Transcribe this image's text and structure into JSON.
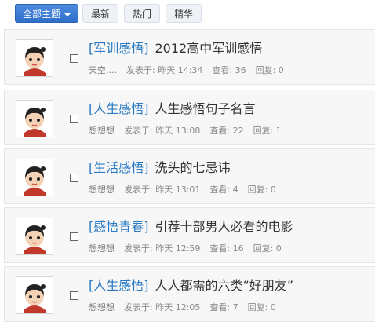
{
  "tabs": {
    "all": "全部主题",
    "latest": "最新",
    "hot": "热门",
    "essence": "精华"
  },
  "threads": [
    {
      "category": "[军训感悟]",
      "subject": "2012高中军训感悟",
      "author": "天空....",
      "posted": "发表于: 昨天 14:34",
      "views": "查看: 36",
      "replies": "回复: 0"
    },
    {
      "category": "[人生感悟]",
      "subject": "人生感悟句子名言",
      "author": "想想想",
      "posted": "发表于: 昨天 13:08",
      "views": "查看: 22",
      "replies": "回复: 1"
    },
    {
      "category": "[生活感悟]",
      "subject": "洗头的七忌讳",
      "author": "想想想",
      "posted": "发表于: 昨天 13:01",
      "views": "查看: 4",
      "replies": "回复: 0"
    },
    {
      "category": "[感悟青春]",
      "subject": "引荐十部男人必看的电影",
      "author": "想想想",
      "posted": "发表于: 昨天 12:59",
      "views": "查看: 16",
      "replies": "回复: 0"
    },
    {
      "category": "[人生感悟]",
      "subject": "人人都需的六类“好朋友”",
      "author": "想想想",
      "posted": "发表于: 昨天 12:05",
      "views": "查看: 7",
      "replies": "回复: 0"
    }
  ]
}
